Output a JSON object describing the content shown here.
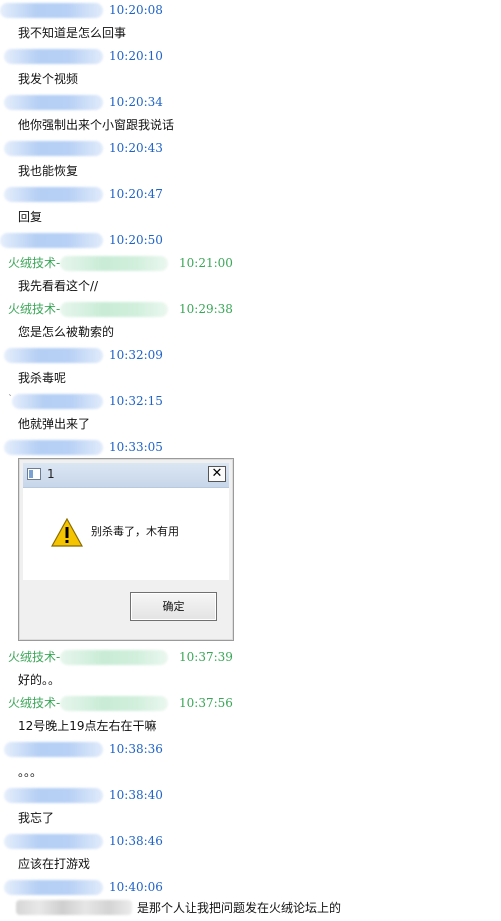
{
  "messages": [
    {
      "sender": "",
      "sender_blur": "blue",
      "time": "10:20:08",
      "time_color": "blue",
      "text": "我不知道是怎么回事"
    },
    {
      "sender": "",
      "sender_blur": "blue",
      "time": "10:20:10",
      "time_color": "blue",
      "text": "我发个视频"
    },
    {
      "sender": "",
      "sender_blur": "blue",
      "time": "10:20:34",
      "time_color": "blue",
      "text": "他你强制出来个小窗跟我说话"
    },
    {
      "sender": "",
      "sender_blur": "blue",
      "time": "10:20:43",
      "time_color": "blue",
      "text": "我也能恢复"
    },
    {
      "sender": "",
      "sender_blur": "blue",
      "time": "10:20:47",
      "time_color": "blue",
      "text": "回复"
    },
    {
      "sender": "",
      "sender_blur": "blue",
      "time": "10:20:50",
      "time_color": "blue",
      "text": ""
    },
    {
      "sender": "火绒技术-",
      "sender_blur": "green",
      "time": "10:21:00",
      "time_color": "green",
      "text": "我先看看这个//"
    },
    {
      "sender": "火绒技术-",
      "sender_blur": "green",
      "time": "10:29:38",
      "time_color": "green",
      "text": "您是怎么被勒索的"
    },
    {
      "sender": "",
      "sender_blur": "blue",
      "time": "10:32:09",
      "time_color": "blue",
      "text": "我杀毒呢"
    },
    {
      "sender": "",
      "sender_blur": "blue",
      "time": "10:32:15",
      "time_color": "blue",
      "text": "他就弹出来了"
    },
    {
      "sender": "",
      "sender_blur": "blue",
      "time": "10:33:05",
      "time_color": "blue",
      "text": ""
    },
    {
      "sender": "火绒技术-",
      "sender_blur": "green",
      "time": "10:37:39",
      "time_color": "green",
      "text": "好的。。"
    },
    {
      "sender": "火绒技术-",
      "sender_blur": "green",
      "time": "10:37:56",
      "time_color": "green",
      "text": "12号晚上19点左右在干嘛"
    },
    {
      "sender": "",
      "sender_blur": "blue",
      "time": "10:38:36",
      "time_color": "blue",
      "text": "。。。"
    },
    {
      "sender": "",
      "sender_blur": "blue",
      "time": "10:38:40",
      "time_color": "blue",
      "text": "我忘了"
    },
    {
      "sender": "",
      "sender_blur": "blue",
      "time": "10:38:46",
      "time_color": "blue",
      "text": "应该在打游戏"
    },
    {
      "sender": "",
      "sender_blur": "blue",
      "time": "10:40:06",
      "time_color": "blue",
      "text": ""
    }
  ],
  "stray_mark": "`",
  "dialog": {
    "title": "1",
    "message": "别杀毒了，木有用",
    "ok_label": "确定",
    "close_label": "✕",
    "icon": "warning-icon"
  },
  "footer_text": "是那个人让我把问题发在火绒论坛上的",
  "colors": {
    "time_blue": "#1f63c8",
    "sender_green": "#3aa757",
    "text": "#111111",
    "warning_yellow": "#f5c400"
  }
}
